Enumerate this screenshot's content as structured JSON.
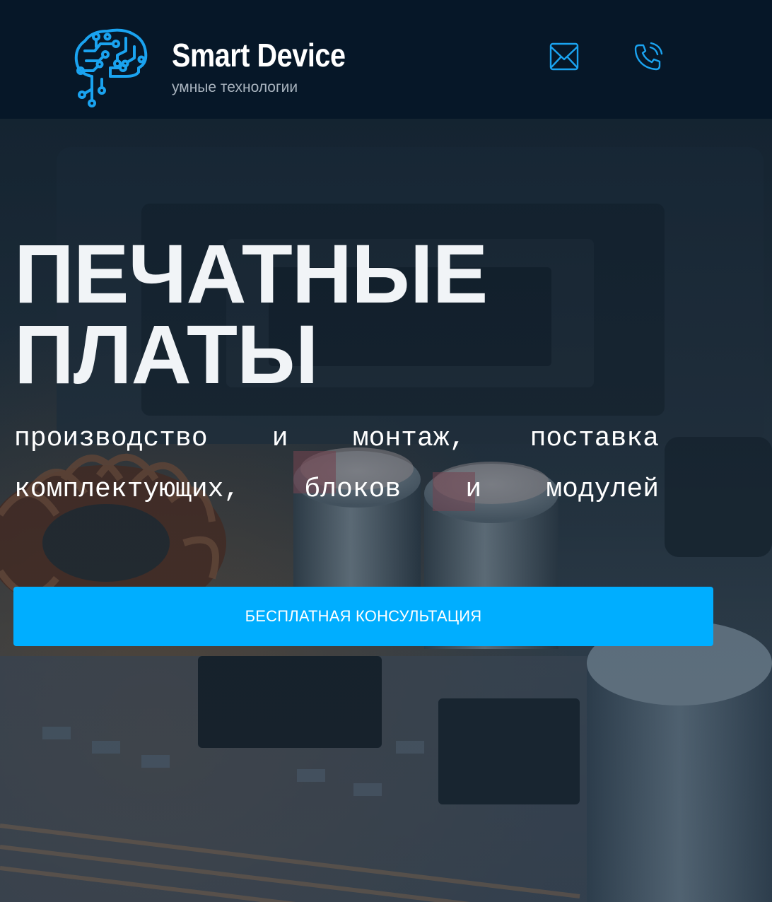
{
  "header": {
    "brand": "Smart Device",
    "tagline": "умные технологии",
    "logo_icon": "circuit-brain-icon",
    "contact_icons": [
      "mail-icon",
      "phone-icon"
    ]
  },
  "hero": {
    "title_lines": [
      "ПЕЧАТНЫЕ",
      "ПЛАТЫ"
    ],
    "description_lines": [
      "производство и монтаж, поставка",
      "комплектующих, блоков и модулей"
    ],
    "cta_label": "БЕСПЛАТНАЯ КОНСУЛЬТАЦИЯ",
    "background": "circuit-board-photo"
  },
  "colors": {
    "header_bg": "#061728",
    "accent": "#00aeff",
    "icon_accent": "#1aa3f0",
    "tagline": "#a9b4bf",
    "text": "#ffffff"
  }
}
